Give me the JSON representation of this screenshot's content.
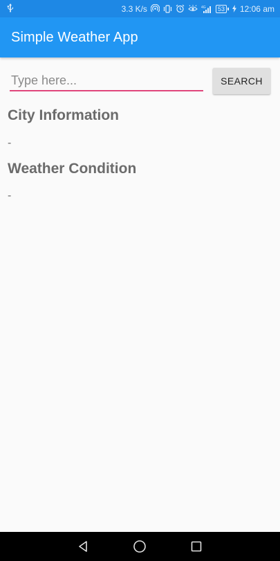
{
  "status_bar": {
    "usb_icon": "usb-icon",
    "network_speed": "3.3 K/s",
    "icons": [
      "hotspot-icon",
      "vibrate-icon",
      "alarm-icon",
      "eye-comfort-icon",
      "signal-icon"
    ],
    "battery_level": "53",
    "time": "12:06 am"
  },
  "app_bar": {
    "title": "Simple Weather App",
    "color": "#2196f3"
  },
  "search": {
    "placeholder": "Type here...",
    "value": "",
    "button_label": "SEARCH",
    "underline_color": "#e0457b"
  },
  "city_section": {
    "title": "City Information",
    "value": "-"
  },
  "weather_section": {
    "title": "Weather Condition",
    "value": "-"
  },
  "nav_bar": {
    "buttons": [
      "back-icon",
      "home-icon",
      "recents-icon"
    ]
  }
}
